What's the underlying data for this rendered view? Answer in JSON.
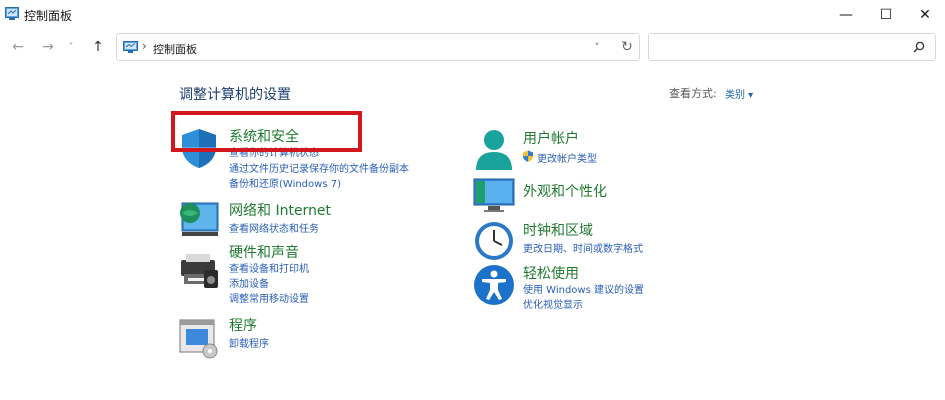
{
  "window": {
    "title": "控制面板",
    "min_glyph": "—",
    "max_glyph": "☐",
    "close_glyph": "✕"
  },
  "nav": {
    "back_glyph": "←",
    "forward_glyph": "→",
    "recent_glyph": "˅",
    "up_glyph": "↑",
    "breadcrumb_separator": "›",
    "breadcrumb": "控制面板",
    "dropdown_glyph": "˅",
    "refresh_glyph": "↻",
    "search_placeholder": ""
  },
  "header": {
    "title": "调整计算机的设置",
    "view_by_label": "查看方式:",
    "view_by_value": "类别 ▾"
  },
  "categories_left": [
    {
      "name": "系统和安全",
      "links": [
        "查看你的计算机状态",
        "通过文件历史记录保存你的文件备份副本",
        "备份和还原(Windows 7)"
      ]
    },
    {
      "name": "网络和 Internet",
      "links": [
        "查看网络状态和任务"
      ]
    },
    {
      "name": "硬件和声音",
      "links": [
        "查看设备和打印机",
        "添加设备",
        "调整常用移动设置"
      ]
    },
    {
      "name": "程序",
      "links": [
        "卸载程序"
      ]
    }
  ],
  "categories_right": [
    {
      "name": "用户帐户",
      "links": [
        "更改帐户类型"
      ]
    },
    {
      "name": "外观和个性化",
      "links": []
    },
    {
      "name": "时钟和区域",
      "links": [
        "更改日期、时间或数字格式"
      ]
    },
    {
      "name": "轻松使用",
      "links": [
        "使用 Windows 建议的设置",
        "优化视觉显示"
      ]
    }
  ],
  "colors": {
    "heading_green": "#1f7a2f",
    "link_blue": "#2a5eb8",
    "highlight_red": "#d4161f",
    "title_blue": "#1a3d6e"
  }
}
